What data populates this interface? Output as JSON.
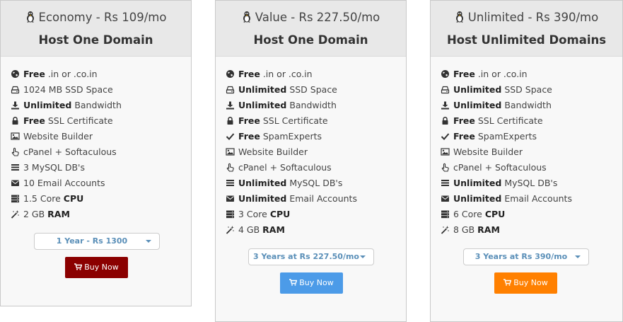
{
  "plans": [
    {
      "title": "Economy - Rs 109/mo",
      "subtitle": "Host One Domain",
      "features": [
        {
          "icon": "globe-icon",
          "bold": "Free",
          "text": " .in or .co.in"
        },
        {
          "icon": "hdd-icon",
          "bold": "",
          "text": "1024 MB SSD Space"
        },
        {
          "icon": "download-icon",
          "bold": "Unlimited",
          "text": " Bandwidth"
        },
        {
          "icon": "lock-icon",
          "bold": "Free",
          "text": " SSL Certificate"
        },
        {
          "icon": "image-icon",
          "bold": "",
          "text": "Website Builder"
        },
        {
          "icon": "pointer-icon",
          "bold": "",
          "text": "cPanel + Softaculous"
        },
        {
          "icon": "list-icon",
          "bold": "",
          "text": "3 MySQL DB's"
        },
        {
          "icon": "envelope-icon",
          "bold": "",
          "text": "10 Email Accounts"
        },
        {
          "icon": "server-icon",
          "bold": "CPU",
          "text": "1.5 Core ",
          "bold_after": true
        },
        {
          "icon": "magic-icon",
          "bold": "RAM",
          "text": "2 GB ",
          "bold_after": true
        }
      ],
      "cycle": "1 Year - Rs 1300",
      "button": "Buy Now",
      "button_color": "#8b0000"
    },
    {
      "title": "Value - Rs 227.50/mo",
      "subtitle": "Host One Domain",
      "features": [
        {
          "icon": "globe-icon",
          "bold": "Free",
          "text": " .in or .co.in"
        },
        {
          "icon": "hdd-icon",
          "bold": "Unlimited",
          "text": " SSD Space"
        },
        {
          "icon": "download-icon",
          "bold": "Unlimited",
          "text": " Bandwidth"
        },
        {
          "icon": "lock-icon",
          "bold": "Free",
          "text": " SSL Certificate"
        },
        {
          "icon": "check-icon",
          "bold": "Free",
          "text": " SpamExperts"
        },
        {
          "icon": "image-icon",
          "bold": "",
          "text": "Website Builder"
        },
        {
          "icon": "pointer-icon",
          "bold": "",
          "text": "cPanel + Softaculous"
        },
        {
          "icon": "list-icon",
          "bold": "Unlimited",
          "text": " MySQL DB's"
        },
        {
          "icon": "envelope-icon",
          "bold": "Unlimited",
          "text": " Email Accounts"
        },
        {
          "icon": "server-icon",
          "bold": "CPU",
          "text": "3 Core ",
          "bold_after": true
        },
        {
          "icon": "magic-icon",
          "bold": "RAM",
          "text": "4 GB ",
          "bold_after": true
        }
      ],
      "cycle": "3 Years at Rs 227.50/mo",
      "button": "Buy Now",
      "button_color": "#4c9be8"
    },
    {
      "title": "Unlimited - Rs 390/mo",
      "subtitle": "Host Unlimited Domains",
      "features": [
        {
          "icon": "globe-icon",
          "bold": "Free",
          "text": " .in or .co.in"
        },
        {
          "icon": "hdd-icon",
          "bold": "Unlimited",
          "text": " SSD Space"
        },
        {
          "icon": "download-icon",
          "bold": "Unlimited",
          "text": " Bandwidth"
        },
        {
          "icon": "lock-icon",
          "bold": "Free",
          "text": " SSL Certificate"
        },
        {
          "icon": "check-icon",
          "bold": "Free",
          "text": " SpamExperts"
        },
        {
          "icon": "image-icon",
          "bold": "",
          "text": "Website Builder"
        },
        {
          "icon": "pointer-icon",
          "bold": "",
          "text": "cPanel + Softaculous"
        },
        {
          "icon": "list-icon",
          "bold": "Unlimited",
          "text": " MySQL DB's"
        },
        {
          "icon": "envelope-icon",
          "bold": "Unlimited",
          "text": " Email Accounts"
        },
        {
          "icon": "server-icon",
          "bold": "CPU",
          "text": "6 Core ",
          "bold_after": true
        },
        {
          "icon": "magic-icon",
          "bold": "RAM",
          "text": "8 GB ",
          "bold_after": true
        }
      ],
      "cycle": "3 Years at Rs 390/mo",
      "button": "Buy Now",
      "button_color": "#ff8000"
    }
  ]
}
